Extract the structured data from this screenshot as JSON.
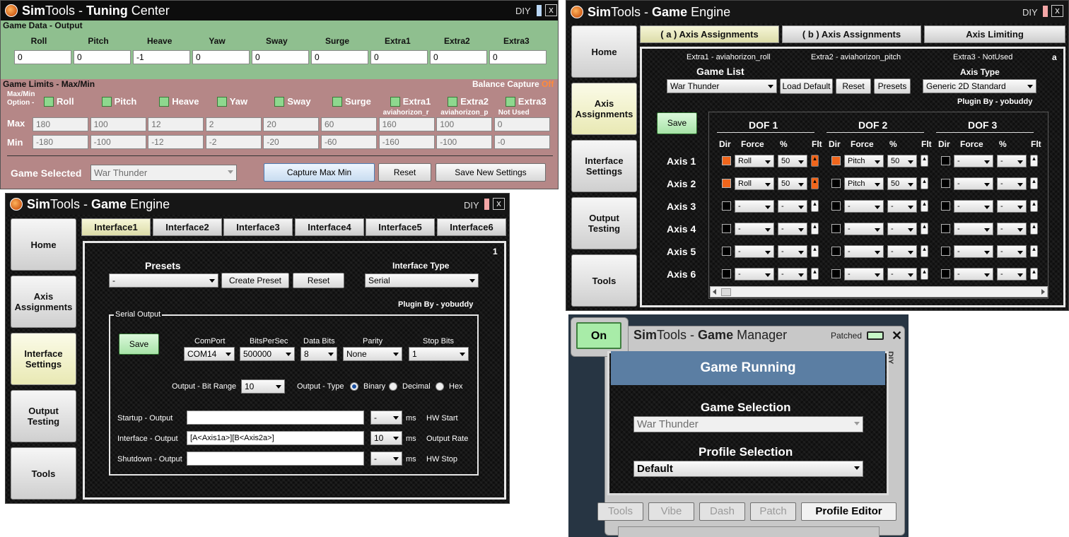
{
  "tuning": {
    "title_sim": "Sim",
    "title_tools": "Tools - ",
    "title_bold": "Tuning",
    "title_rest": " Center",
    "diy": "DIY",
    "close": "x",
    "game_data_title": "Game Data - Output",
    "axes": [
      "Roll",
      "Pitch",
      "Heave",
      "Yaw",
      "Sway",
      "Surge",
      "Extra1",
      "Extra2",
      "Extra3"
    ],
    "outputs": [
      "0",
      "0",
      "-1",
      "0",
      "0",
      "0",
      "0",
      "0",
      "0"
    ],
    "limits_title": "Game Limits - Max/Min",
    "balance_label": "Balance Capture",
    "balance_value": "Off",
    "option_label_1": "Max/Min",
    "option_label_2": "Option -",
    "extra_subs": [
      "aviahorizon_r",
      "aviahorizon_p",
      "Not Used"
    ],
    "max_label": "Max",
    "min_label": "Min",
    "max": [
      "180",
      "100",
      "12",
      "2",
      "20",
      "60",
      "160",
      "100",
      "0"
    ],
    "min": [
      "-180",
      "-100",
      "-12",
      "-2",
      "-20",
      "-60",
      "-160",
      "-100",
      "-0"
    ],
    "game_selected_label": "Game Selected",
    "game_selected": "War Thunder",
    "capture_btn": "Capture Max Min",
    "reset_btn": "Reset",
    "save_btn": "Save New Settings",
    "colors": {
      "game_data_bg": "#8fbf8f",
      "limits_bg": "#b58787"
    }
  },
  "engine_iface": {
    "title_sim": "Sim",
    "title_tools": "Tools - ",
    "title_bold": "Game",
    "title_rest": " Engine",
    "diy": "DIY",
    "close": "x",
    "side": [
      "Home",
      "Axis Assignments",
      "Interface Settings",
      "Output Testing",
      "Tools"
    ],
    "tabs": [
      "Interface1",
      "Interface2",
      "Interface3",
      "Interface4",
      "Interface5",
      "Interface6"
    ],
    "panel_num": "1",
    "presets_label": "Presets",
    "presets_value": "-",
    "create_preset": "Create Preset",
    "reset": "Reset",
    "itype_label": "Interface Type",
    "itype_value": "Serial",
    "plugin_by": "Plugin By - yobuddy",
    "serial_output": "Serial Output",
    "save": "Save",
    "comport_label": "ComPort",
    "comport": "COM14",
    "bps_label": "BitsPerSec",
    "bps": "500000",
    "databits_label": "Data Bits",
    "databits": "8",
    "parity_label": "Parity",
    "parity": "None",
    "stopbits_label": "Stop Bits",
    "stopbits": "1",
    "bitrange_label": "Output - Bit Range",
    "bitrange": "10",
    "otype_label": "Output - Type",
    "otypes": [
      "Binary",
      "Decimal",
      "Hex"
    ],
    "startup_label": "Startup - Output",
    "startup_value": "",
    "startup_ms": "-",
    "hw_start": "HW Start",
    "iface_label": "Interface - Output",
    "iface_value": "[A<Axis1a>][B<Axis2a>]",
    "iface_ms": "10",
    "out_rate": "Output Rate",
    "shutdown_label": "Shutdown - Output",
    "shutdown_value": "",
    "shutdown_ms": "-",
    "hw_stop": "HW Stop",
    "ms": "ms"
  },
  "engine_axis": {
    "title_sim": "Sim",
    "title_tools": "Tools - ",
    "title_bold": "Game",
    "title_rest": " Engine",
    "diy": "DIY",
    "close": "x",
    "side": [
      "Home",
      "Axis Assignments",
      "Interface Settings",
      "Output Testing",
      "Tools"
    ],
    "tabs": [
      "( a ) Axis Assignments",
      "( b ) Axis Assignments",
      "Axis Limiting"
    ],
    "extra1": "Extra1 - aviahorizon_roll",
    "extra2": "Extra2 - aviahorizon_pitch",
    "extra3": "Extra3 - NotUsed",
    "corner": "a",
    "game_list_label": "Game List",
    "game_list_value": "War Thunder",
    "load_default": "Load Default",
    "reset": "Reset",
    "presets": "Presets",
    "axis_type_label": "Axis Type",
    "axis_type_value": "Generic 2D Standard",
    "plugin_by": "Plugin By - yobuddy",
    "save": "Save",
    "dof": [
      "DOF 1",
      "DOF 2",
      "DOF 3"
    ],
    "col_heads": [
      "Dir",
      "Force",
      "%",
      "Flt"
    ],
    "axes": [
      "Axis 1",
      "Axis 2",
      "Axis 3",
      "Axis 4",
      "Axis 5",
      "Axis 6"
    ],
    "a1d1": {
      "force": "Roll",
      "pct": "50"
    },
    "a1d2": {
      "force": "Pitch",
      "pct": "50"
    },
    "a2d1": {
      "force": "Roll",
      "pct": "50"
    },
    "a2d2": {
      "force": "Pitch",
      "pct": "50"
    },
    "empty": "-"
  },
  "manager": {
    "on": "On",
    "title_sim": "Sim",
    "title_tools": "Tools - ",
    "title_bold": "Game",
    "title_rest": " Manager",
    "patched": "Patched",
    "close": "✕",
    "diy": "DIY",
    "status": "Game Running",
    "game_sel_label": "Game Selection",
    "game_sel_value": "War Thunder",
    "profile_label": "Profile Selection",
    "profile_value": "Default",
    "buttons": [
      "Tools",
      "Vibe",
      "Dash",
      "Patch",
      "Profile Editor"
    ]
  }
}
